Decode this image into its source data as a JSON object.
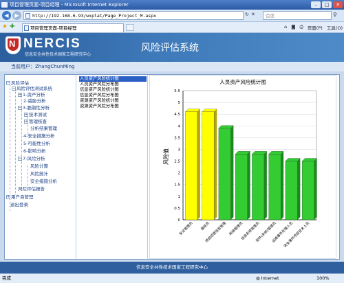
{
  "window": {
    "title": "项目管理页面-项目经理 - Microsoft Internet Explorer",
    "minimize": "–",
    "maximize": "□",
    "close": "✕"
  },
  "address": {
    "url": "http://192.168.6.93/wxplat/Page_Project_M.aspx",
    "search_placeholder": "百度",
    "refresh": "↻",
    "stop": "✕"
  },
  "tabs": [
    {
      "label": "项目管理页面-项目经理"
    }
  ],
  "command": {
    "page_label": "页面(P)",
    "tools_label": "工具(O)"
  },
  "banner": {
    "logo": "NERCIS",
    "logo_sub": "信息安全共性技术国家工程研究中心",
    "system_title": "风险评估系统"
  },
  "user": {
    "label": "当前用户：ZhangChunMing"
  },
  "tree": [
    {
      "label": "风险评估",
      "expander": "−"
    },
    {
      "label": "风险评估测试系统",
      "expander": "−"
    },
    {
      "label": "1-资产分析",
      "expander": "+"
    },
    {
      "label": "2-威胁分析",
      "expander": ""
    },
    {
      "label": "3-脆弱性分析",
      "expander": "−"
    },
    {
      "label": "技术测试",
      "expander": "+"
    },
    {
      "label": "管理核查",
      "expander": "+"
    },
    {
      "label": "分析结果管理",
      "expander": ""
    },
    {
      "label": "4-安全措施分析",
      "expander": ""
    },
    {
      "label": "5-可能性分析",
      "expander": ""
    },
    {
      "label": "6-影响分析",
      "expander": ""
    },
    {
      "label": "7-风险分析",
      "expander": "−"
    },
    {
      "label": "风险计算",
      "expander": ""
    },
    {
      "label": "风险统计",
      "expander": ""
    },
    {
      "label": "安全措施分析",
      "expander": ""
    },
    {
      "label": "风险评估报告",
      "expander": ""
    },
    {
      "label": "用户自管理",
      "expander": "+"
    },
    {
      "label": "退出登录",
      "expander": ""
    }
  ],
  "list": [
    {
      "label": "人员资产风险统计图",
      "selected": true
    },
    {
      "label": "人员资产风险分布图",
      "selected": false
    },
    {
      "label": "信息资产风险统计图",
      "selected": false
    },
    {
      "label": "信息资产风险分布图",
      "selected": false
    },
    {
      "label": "资源资产风险统计图",
      "selected": false
    },
    {
      "label": "资源资产风险分布图",
      "selected": false
    }
  ],
  "chart_data": {
    "type": "bar",
    "title": "人员资产风险统计图",
    "ylabel": "风险值",
    "xlabel": "",
    "ylim": [
      0,
      5.5
    ],
    "yticks": [
      0,
      0.5,
      1,
      1.5,
      2,
      2.5,
      3,
      3.5,
      4,
      4.5,
      5,
      5.5
    ],
    "categories": [
      "安全管理员",
      "值班员",
      "项目经理信息管理",
      "网络管理员",
      "信息系统管理员",
      "软件(系统)管理员",
      "运维事件处理人员",
      "安全事件项目技术人员"
    ],
    "values": [
      4.6,
      4.6,
      3.9,
      2.8,
      2.8,
      2.8,
      2.5,
      2.5
    ],
    "colors": [
      "#ffff00",
      "#ffff00",
      "#33cc33",
      "#33cc33",
      "#33cc33",
      "#33cc33",
      "#33cc33",
      "#33cc33"
    ],
    "grid": true,
    "legend": "none"
  },
  "footer": {
    "text": "信息安全共性技术国家工程研究中心"
  },
  "status": {
    "text": "完成",
    "zone": "Internet",
    "zoom": "100%"
  }
}
